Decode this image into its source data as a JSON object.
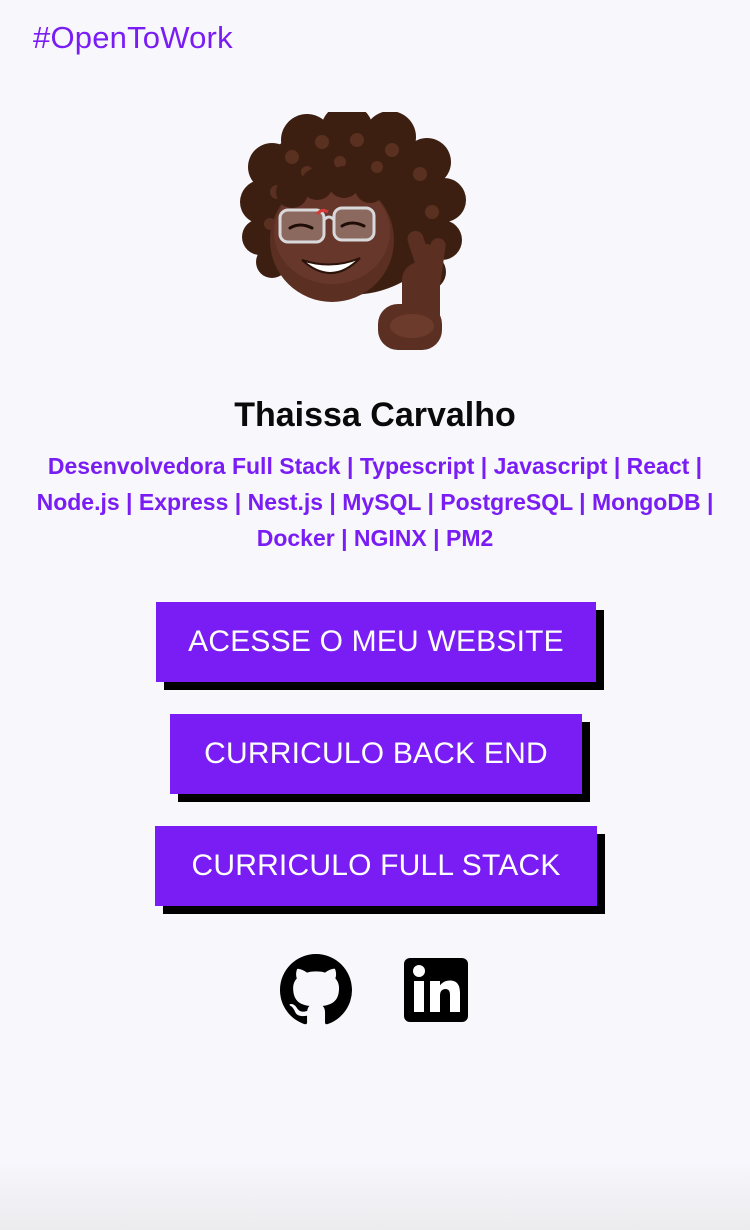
{
  "header": {
    "hashtag": "#OpenToWork"
  },
  "profile": {
    "name": "Thaissa Carvalho",
    "stack_line": "Desenvolvedora Full Stack | Typescript | Javascript | React | Node.js | Express | Nest.js | MySQL | PostgreSQL | MongoDB | Docker | NGINX | PM2",
    "avatar_icon": "memoji-avatar"
  },
  "buttons": {
    "website": "ACESSE O MEU WEBSITE",
    "cv_backend": "CURRICULO BACK END",
    "cv_fullstack": "CURRICULO FULL STACK"
  },
  "social": {
    "github_icon": "github-icon",
    "linkedin_icon": "linkedin-icon"
  },
  "colors": {
    "accent": "#7a1df5",
    "background": "#f7f7fc",
    "text": "#0a0a0a",
    "shadow": "#000000"
  }
}
